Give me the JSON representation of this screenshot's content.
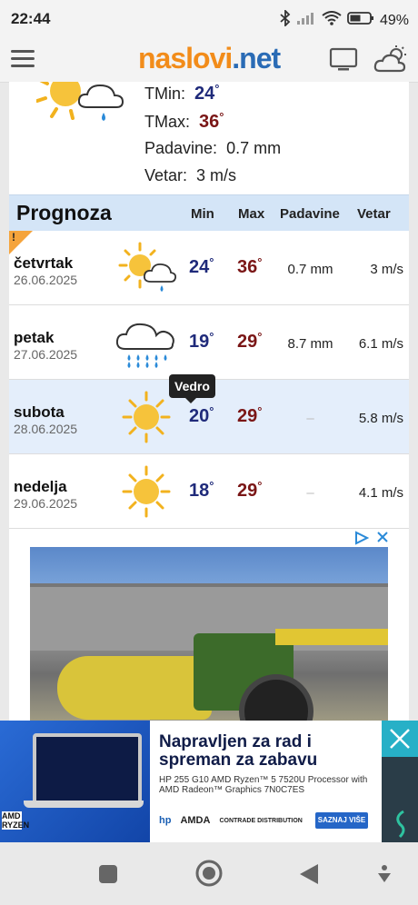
{
  "status": {
    "time": "22:44",
    "battery": "49%"
  },
  "appbar": {
    "logo_part1": "naslovi",
    "logo_part2": ".net"
  },
  "today": {
    "tmin_label": "TMin:",
    "tmin_value": "24",
    "tmax_label": "TMax:",
    "tmax_value": "36",
    "rain_label": "Padavine:",
    "rain_value": "0.7 mm",
    "wind_label": "Vetar:",
    "wind_value": "3 m/s",
    "degree": "°"
  },
  "forecast": {
    "title": "Prognoza",
    "columns": {
      "min": "Min",
      "max": "Max",
      "rain": "Padavine",
      "wind": "Vetar"
    },
    "rows": [
      {
        "day": "četvrtak",
        "date": "26.06.2025",
        "min": "24",
        "max": "36",
        "rain": "0.7 mm",
        "wind": "3 m/s",
        "icon": "sun-cloud-rain-icon",
        "warning": "!"
      },
      {
        "day": "petak",
        "date": "27.06.2025",
        "min": "19",
        "max": "29",
        "rain": "8.7 mm",
        "wind": "6.1 m/s",
        "icon": "rain-cloud-icon"
      },
      {
        "day": "subota",
        "date": "28.06.2025",
        "min": "20",
        "max": "29",
        "rain": "–",
        "wind": "5.8 m/s",
        "icon": "sun-icon"
      },
      {
        "day": "nedelja",
        "date": "29.06.2025",
        "min": "18",
        "max": "29",
        "rain": "–",
        "wind": "4.1 m/s",
        "icon": "sun-icon"
      }
    ],
    "tooltip": "Vedro"
  },
  "ad_bottom": {
    "headline": "Napravljen za rad i spreman za zabavu",
    "fine": "HP 255 G10 AMD Ryzen™ 5 7520U Processor with AMD Radeon™ Graphics 7N0C7ES",
    "logo_amd": "AMDA",
    "logo_hp": "hp",
    "logo_partner": "CONTRADE DISTRIBUTION",
    "cta": "SAZNAJ VIŠE",
    "brand_left": "AMD\nRYZEN"
  }
}
